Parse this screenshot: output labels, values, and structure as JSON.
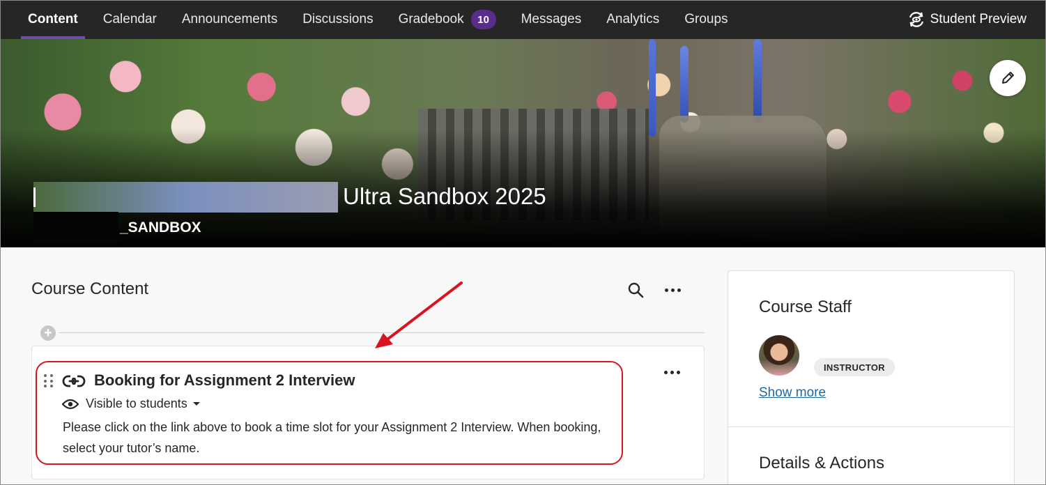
{
  "nav": {
    "tabs": [
      {
        "label": "Content",
        "active": true
      },
      {
        "label": "Calendar"
      },
      {
        "label": "Announcements"
      },
      {
        "label": "Discussions"
      },
      {
        "label": "Gradebook",
        "badge": "10"
      },
      {
        "label": "Messages"
      },
      {
        "label": "Analytics"
      },
      {
        "label": "Groups"
      }
    ],
    "student_preview": "Student Preview"
  },
  "banner": {
    "course_title": "Ultra Sandbox 2025",
    "course_code": "_SANDBOX"
  },
  "content": {
    "title": "Course Content",
    "item": {
      "title": "Booking for Assignment 2 Interview",
      "visibility": "Visible to students",
      "description": "Please click on the link above to book a time slot for your Assignment 2 Interview. When booking, select your tutor’s name."
    }
  },
  "staff": {
    "title": "Course Staff",
    "role": "INSTRUCTOR",
    "show_more": "Show more",
    "details_title": "Details & Actions"
  },
  "colors": {
    "nav_bg": "#262626",
    "accent_purple": "#6f4ea8",
    "badge_bg": "#5a2d8c",
    "annotation_red": "#d9141e",
    "link_blue": "#1a6aa6"
  }
}
